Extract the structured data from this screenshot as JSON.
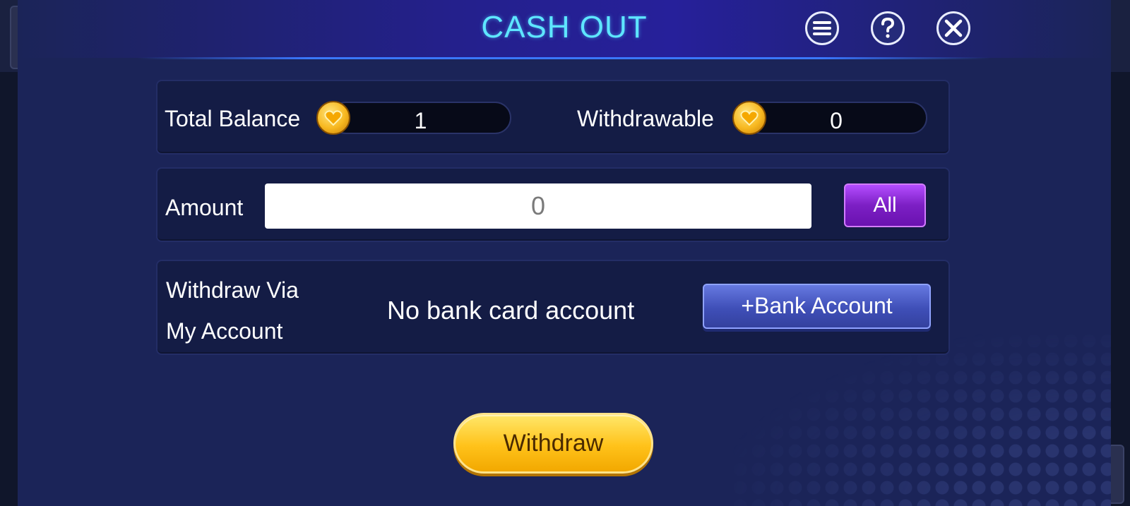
{
  "header": {
    "title": "CASH OUT",
    "menu_icon": "menu-icon",
    "help_icon": "question-icon",
    "close_icon": "close-icon"
  },
  "balance": {
    "total_label": "Total Balance",
    "total_value": "1",
    "withdrawable_label": "Withdrawable",
    "withdrawable_value": "0",
    "coin_icon": "coin-heart-icon"
  },
  "amount": {
    "label": "Amount",
    "value": "0",
    "all_label": "All"
  },
  "withdraw_via": {
    "label_line1": "Withdraw Via",
    "label_line2": "My Account",
    "status": "No bank card account",
    "add_bank_label": "+Bank Account"
  },
  "withdraw_button": "Withdraw",
  "colors": {
    "title": "#5ee6ff",
    "dialog_bg": "#1b2458",
    "panel_bg": "#141c45",
    "all_button": "#8a2be2",
    "bank_button": "#4a5bc8",
    "withdraw_button": "#ffc21a"
  }
}
